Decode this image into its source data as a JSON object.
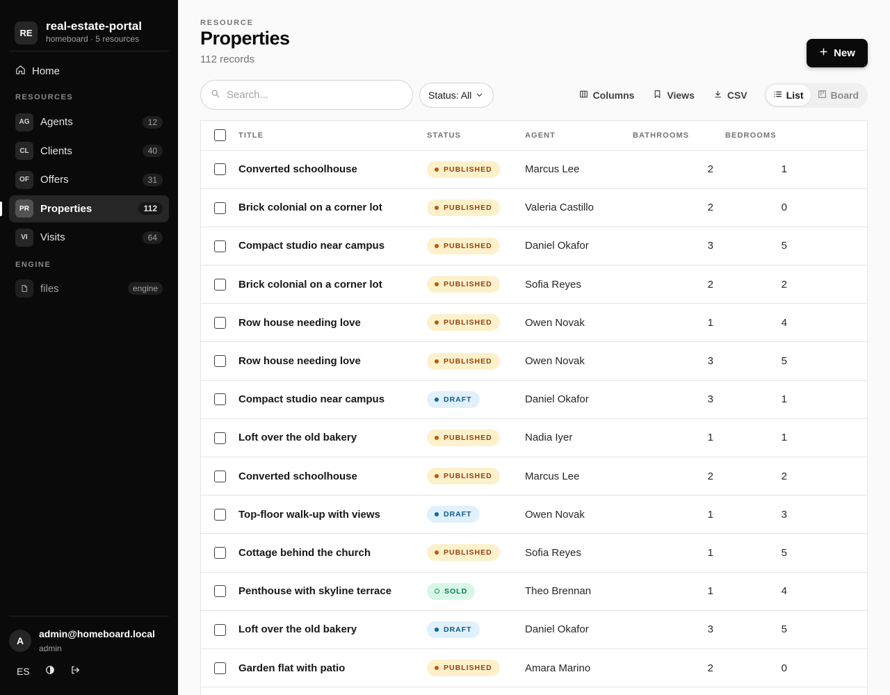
{
  "brand": {
    "logo": "RE",
    "name": "real-estate-portal",
    "subtitle": "homeboard · 5 resources"
  },
  "nav": {
    "home_label": "Home",
    "resources_label": "RESOURCES",
    "engine_label": "ENGINE",
    "items": [
      {
        "abbr": "AG",
        "label": "Agents",
        "count": "12",
        "active": false
      },
      {
        "abbr": "CL",
        "label": "Clients",
        "count": "40",
        "active": false
      },
      {
        "abbr": "OF",
        "label": "Offers",
        "count": "31",
        "active": false
      },
      {
        "abbr": "PR",
        "label": "Properties",
        "count": "112",
        "active": true
      },
      {
        "abbr": "VI",
        "label": "Visits",
        "count": "64",
        "active": false
      }
    ],
    "engine_items": [
      {
        "label": "files",
        "tag": "engine"
      }
    ]
  },
  "user": {
    "initial": "A",
    "email": "admin@homeboard.local",
    "role": "admin",
    "lang": "ES"
  },
  "header": {
    "eyebrow": "RESOURCE",
    "title": "Properties",
    "subtitle": "112 records",
    "new_label": "New"
  },
  "toolbar": {
    "search_placeholder": "Search...",
    "status_filter": "Status: All",
    "columns_label": "Columns",
    "views_label": "Views",
    "csv_label": "CSV",
    "list_label": "List",
    "board_label": "Board"
  },
  "table": {
    "columns": [
      "TITLE",
      "STATUS",
      "AGENT",
      "BATHROOMS",
      "BEDROOMS"
    ],
    "rows": [
      {
        "title": "Converted schoolhouse",
        "status": "PUBLISHED",
        "kind": "published",
        "agent": "Marcus Lee",
        "bathrooms": "2",
        "bedrooms": "1"
      },
      {
        "title": "Brick colonial on a corner lot",
        "status": "PUBLISHED",
        "kind": "published",
        "agent": "Valeria Castillo",
        "bathrooms": "2",
        "bedrooms": "0"
      },
      {
        "title": "Compact studio near campus",
        "status": "PUBLISHED",
        "kind": "published",
        "agent": "Daniel Okafor",
        "bathrooms": "3",
        "bedrooms": "5"
      },
      {
        "title": "Brick colonial on a corner lot",
        "status": "PUBLISHED",
        "kind": "published",
        "agent": "Sofia Reyes",
        "bathrooms": "2",
        "bedrooms": "2"
      },
      {
        "title": "Row house needing love",
        "status": "PUBLISHED",
        "kind": "published",
        "agent": "Owen Novak",
        "bathrooms": "1",
        "bedrooms": "4"
      },
      {
        "title": "Row house needing love",
        "status": "PUBLISHED",
        "kind": "published",
        "agent": "Owen Novak",
        "bathrooms": "3",
        "bedrooms": "5"
      },
      {
        "title": "Compact studio near campus",
        "status": "DRAFT",
        "kind": "draft",
        "agent": "Daniel Okafor",
        "bathrooms": "3",
        "bedrooms": "1"
      },
      {
        "title": "Loft over the old bakery",
        "status": "PUBLISHED",
        "kind": "published",
        "agent": "Nadia Iyer",
        "bathrooms": "1",
        "bedrooms": "1"
      },
      {
        "title": "Converted schoolhouse",
        "status": "PUBLISHED",
        "kind": "published",
        "agent": "Marcus Lee",
        "bathrooms": "2",
        "bedrooms": "2"
      },
      {
        "title": "Top-floor walk-up with views",
        "status": "DRAFT",
        "kind": "draft",
        "agent": "Owen Novak",
        "bathrooms": "1",
        "bedrooms": "3"
      },
      {
        "title": "Cottage behind the church",
        "status": "PUBLISHED",
        "kind": "published",
        "agent": "Sofia Reyes",
        "bathrooms": "1",
        "bedrooms": "5"
      },
      {
        "title": "Penthouse with skyline terrace",
        "status": "SOLD",
        "kind": "sold",
        "agent": "Theo Brennan",
        "bathrooms": "1",
        "bedrooms": "4"
      },
      {
        "title": "Loft over the old bakery",
        "status": "DRAFT",
        "kind": "draft",
        "agent": "Daniel Okafor",
        "bathrooms": "3",
        "bedrooms": "5"
      },
      {
        "title": "Garden flat with patio",
        "status": "PUBLISHED",
        "kind": "published",
        "agent": "Amara Marino",
        "bathrooms": "2",
        "bedrooms": "0"
      }
    ]
  }
}
